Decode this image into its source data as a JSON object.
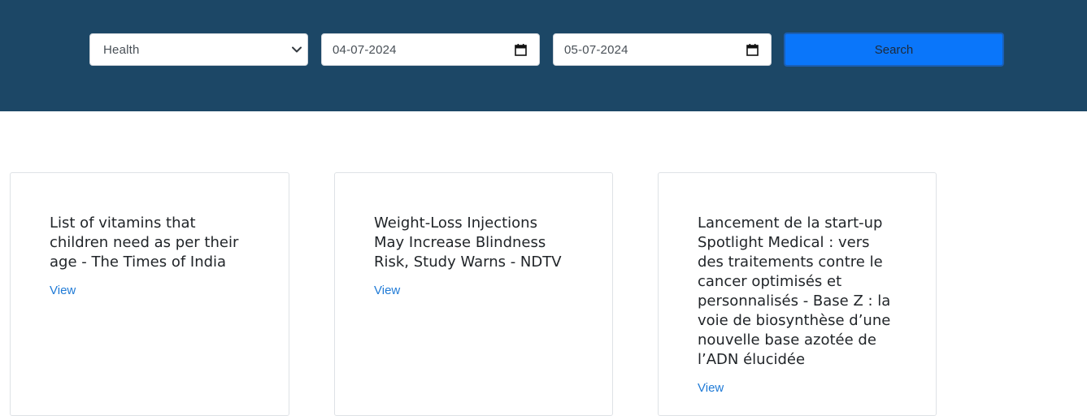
{
  "search_bar": {
    "category_value": "Health",
    "from_date": "04-07-2024",
    "to_date": "05-07-2024",
    "search_label": "Search"
  },
  "articles": [
    {
      "title": "List of vitamins that children need as per their age - The Times of India",
      "link_label": "View"
    },
    {
      "title": "Weight-Loss Injections May Increase Blindness Risk, Study Warns - NDTV",
      "link_label": "View"
    },
    {
      "title": "Lancement de la start-up Spotlight Medical : vers des traitements contre le cancer optimisés et personnalisés - Base Z : la voie de biosynthèse d’une nouvelle base azotée de l’ADN élucidée",
      "link_label": "View"
    }
  ],
  "colors": {
    "header_bg": "#1c4766",
    "button_bg": "#0a76fa",
    "link": "#1f7ad6"
  }
}
